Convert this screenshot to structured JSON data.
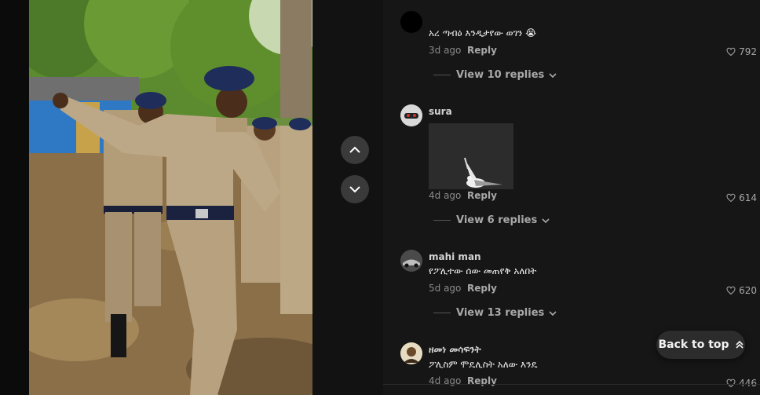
{
  "video": {
    "nav": {
      "up_icon": "chevron-up-icon",
      "down_icon": "chevron-down-icon"
    }
  },
  "comments": [
    {
      "username": "",
      "text": "አረ ጣብዕ እንዲታየው ወገን 😭",
      "age": "3d ago",
      "reply_label": "Reply",
      "likes": "792",
      "view_replies": "View 10 replies"
    },
    {
      "username": "sura",
      "text": "",
      "sticker": "seagull-sticker",
      "age": "4d ago",
      "reply_label": "Reply",
      "likes": "614",
      "view_replies": "View 6 replies"
    },
    {
      "username": "mahi man",
      "text": "የፖሊተው ሰው መጠየቅ አለበት",
      "age": "5d ago",
      "reply_label": "Reply",
      "likes": "620",
      "view_replies": "View 13 replies"
    },
    {
      "username": "ዘመነ መሳፍንት",
      "text": "ፖሊስም ሞዴሊስት አለው እንዴ",
      "age": "4d ago",
      "reply_label": "Reply",
      "likes": "446"
    }
  ],
  "back_to_top": {
    "label": "Back to top",
    "icon": "double-chevron-up-icon"
  },
  "colors": {
    "background": "#121212",
    "panel": "#161616",
    "muted": "#a8a8a8",
    "uniform": "#b9a383",
    "beret": "#1f2d5a"
  }
}
